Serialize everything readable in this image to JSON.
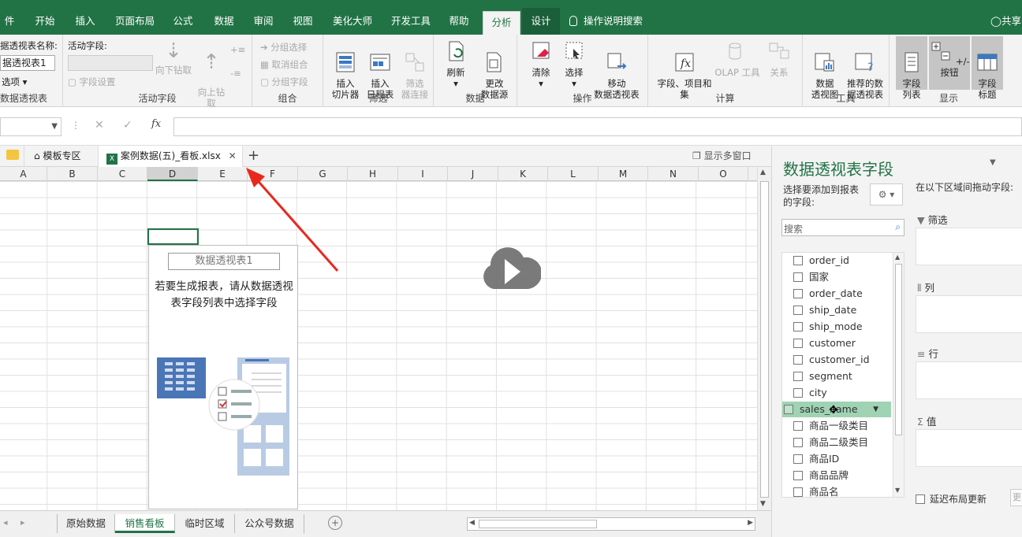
{
  "menu": {
    "tabs": [
      "件",
      "开始",
      "插入",
      "页面布局",
      "公式",
      "数据",
      "审阅",
      "视图",
      "美化大师",
      "开发工具",
      "帮助",
      "分析",
      "设计"
    ],
    "search": "操作说明搜索",
    "share": "共享"
  },
  "ribbon": {
    "pivot_name_label": "据透视表名称:",
    "pivot_name_value": "据透视表1",
    "options": "选项",
    "group1": "数据透视表",
    "active_field_label": "活动字段:",
    "field_settings": "字段设置",
    "drill_down": "向下钻取",
    "drill_up": "向上钻\n取",
    "group2": "活动字段",
    "group_selection": "分组选择",
    "ungroup": "取消组合",
    "group_field": "分组字段",
    "group3": "组合",
    "insert_slicer": "插入\n切片器",
    "insert_timeline": "插入\n日程表",
    "filter_conn": "筛选\n器连接",
    "group4": "筛选",
    "refresh": "刷新",
    "change_source": "更改\n数据源",
    "group5": "数据",
    "clear": "清除",
    "select": "选择",
    "move": "移动\n数据透视表",
    "group6": "操作",
    "fields_items": "字段、项目和\n集",
    "olap": "OLAP 工具",
    "relations": "关系",
    "group7": "计算",
    "pivot_chart": "数据\n透视图",
    "recommended": "推荐的数\n据透视表",
    "group8": "工具",
    "field_list": "字段\n列表",
    "pm_buttons": "+/- 按钮",
    "field_headers": "字段\n标题",
    "group9": "显示"
  },
  "formula_bar": {
    "fx": "fx"
  },
  "doc_tabs": {
    "templates": "模板专区",
    "file": "案例数据(五)_看板.xlsx",
    "multi_window": "显示多窗口"
  },
  "columns": [
    "A",
    "B",
    "C",
    "D",
    "E",
    "F",
    "G",
    "H",
    "I",
    "J",
    "K",
    "L",
    "M",
    "N",
    "O"
  ],
  "pivot_placeholder": {
    "title": "数据透视表1",
    "message": "若要生成报表，请从数据透视表字段列表中选择字段"
  },
  "sheets": [
    "原始数据",
    "销售看板",
    "临时区域",
    "公众号数据"
  ],
  "field_pane": {
    "title": "数据透视表字段",
    "subtitle": "选择要添加到报表的字段:",
    "drag_hint": "在以下区域间拖动字段:",
    "search_placeholder": "搜索",
    "fields": [
      "order_id",
      "国家",
      "order_date",
      "ship_date",
      "ship_mode",
      "customer",
      "customer_id",
      "segment",
      "city",
      "sales_name",
      "商品一级类目",
      "商品二级类目",
      "商品ID",
      "商品品牌",
      "商品名"
    ],
    "highlighted_field": "sales_name",
    "areas": [
      "筛选",
      "列",
      "行",
      "值"
    ],
    "defer_update": "延迟布局更新",
    "update_button": "更"
  },
  "colors": {
    "accent": "#217346",
    "highlight": "#9fd3b4",
    "arrow": "#e8281e"
  }
}
